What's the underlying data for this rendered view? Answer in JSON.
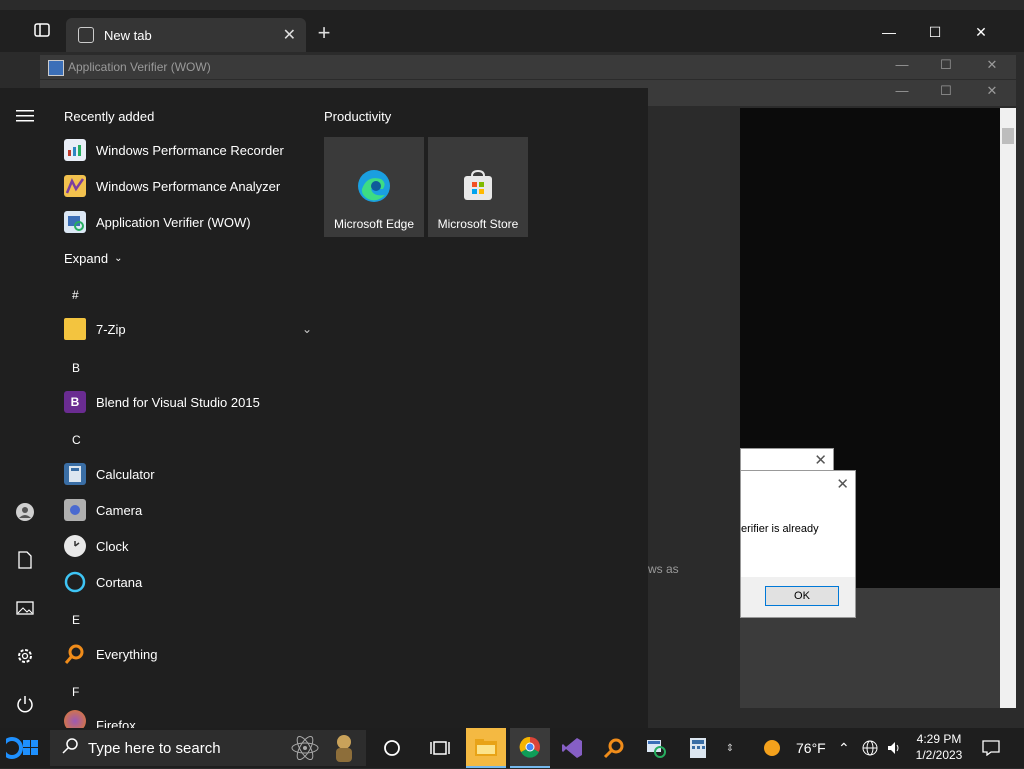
{
  "browser": {
    "tab_label": "New tab",
    "tab_close": "✕",
    "new_tab": "+",
    "min": "—",
    "max": "☐",
    "close": "✕"
  },
  "app_verifier": {
    "title": "Application Verifier (WOW)",
    "min": "—",
    "max": "☐",
    "close": "✕",
    "background_text": "ws as"
  },
  "dialog": {
    "message": "erifier is already",
    "ok_label": "OK",
    "close": "✕"
  },
  "start_menu": {
    "recently_added_title": "Recently added",
    "recent_items": [
      {
        "label": "Windows Performance Recorder",
        "icon": "wpr-icon"
      },
      {
        "label": "Windows Performance Analyzer",
        "icon": "wpa-icon"
      },
      {
        "label": "Application Verifier (WOW)",
        "icon": "app-verifier-icon"
      }
    ],
    "expand_label": "Expand",
    "groups": [
      {
        "letter": "#",
        "items": [
          {
            "label": "7-Zip",
            "icon": "folder-icon"
          }
        ]
      },
      {
        "letter": "B",
        "items": [
          {
            "label": "Blend for Visual Studio 2015",
            "icon": "blend-icon"
          }
        ]
      },
      {
        "letter": "C",
        "items": [
          {
            "label": "Calculator",
            "icon": "calculator-icon"
          },
          {
            "label": "Camera",
            "icon": "camera-icon"
          },
          {
            "label": "Clock",
            "icon": "clock-icon"
          },
          {
            "label": "Cortana",
            "icon": "cortana-icon"
          }
        ]
      },
      {
        "letter": "E",
        "items": [
          {
            "label": "Everything",
            "icon": "everything-icon"
          }
        ]
      },
      {
        "letter": "F",
        "items": [
          {
            "label": "Firefox",
            "icon": "firefox-icon"
          }
        ]
      }
    ],
    "tiles_title": "Productivity",
    "tiles": [
      {
        "label": "Microsoft Edge",
        "icon": "edge-icon"
      },
      {
        "label": "Microsoft Store",
        "icon": "store-icon"
      }
    ]
  },
  "taskbar": {
    "search_placeholder": "Type here to search",
    "weather": "76°F",
    "time": "4:29 PM",
    "date": "1/2/2023"
  }
}
